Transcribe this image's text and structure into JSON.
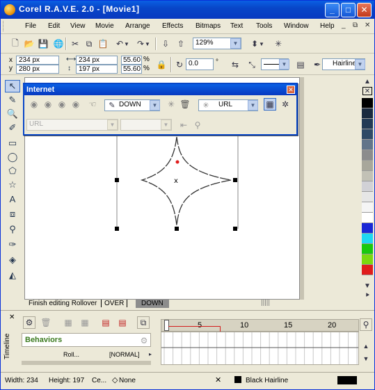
{
  "window": {
    "title": "Corel R.A.V.E. 2.0 - [Movie1]",
    "controls": {
      "minimize": "_",
      "maximize": "□",
      "close": "✕"
    }
  },
  "menu": {
    "items": [
      "File",
      "Edit",
      "View",
      "Movie",
      "Arrange",
      "Effects",
      "Bitmaps",
      "Text",
      "Tools",
      "Window",
      "Help"
    ],
    "doc_controls": [
      "_",
      "⧉",
      "✕"
    ]
  },
  "standard_toolbar": {
    "zoom_value": "129%"
  },
  "property_bar": {
    "x": "234 px",
    "y": "280 px",
    "width": "234 px",
    "height": "197 px",
    "scale_x": "55.60",
    "scale_y": "55.60",
    "scale_unit": "%",
    "rotation": "0.0",
    "degree_symbol": "°",
    "outline_label": "Hairline"
  },
  "internet_panel": {
    "title": "Internet",
    "state_select": "DOWN",
    "url_select": "URL",
    "url_placeholder": "URL"
  },
  "canvas_status": {
    "finish_text": "Finish editing Rollover",
    "tabs": [
      "OVER",
      "DOWN"
    ]
  },
  "timeline": {
    "side_label": "Timeline",
    "behaviors_label": "Behaviors",
    "row_text": "Roll...",
    "row_state": "[NORMAL]",
    "ruler_marks": [
      "5",
      "10",
      "15",
      "20"
    ]
  },
  "status": {
    "width_text": "Width: 234",
    "height_text": "Height: 197",
    "center_text": "Ce...",
    "fill_text": "None",
    "outline_text": "Black  Hairline"
  },
  "colors": {
    "title_blue": "#0846c8",
    "palette": [
      "#000000",
      "#1a2a3f",
      "#223a55",
      "#2f4a66",
      "#62758a",
      "#8c8c8c",
      "#a8a79b",
      "#c2c1b6",
      "#d1d1d6",
      "#e6e6e6",
      "#f5f5f5",
      "#ffffff",
      "#1a27d6",
      "#1ed7f2",
      "#19c90d",
      "#7ad90f",
      "#e01c1c"
    ]
  }
}
